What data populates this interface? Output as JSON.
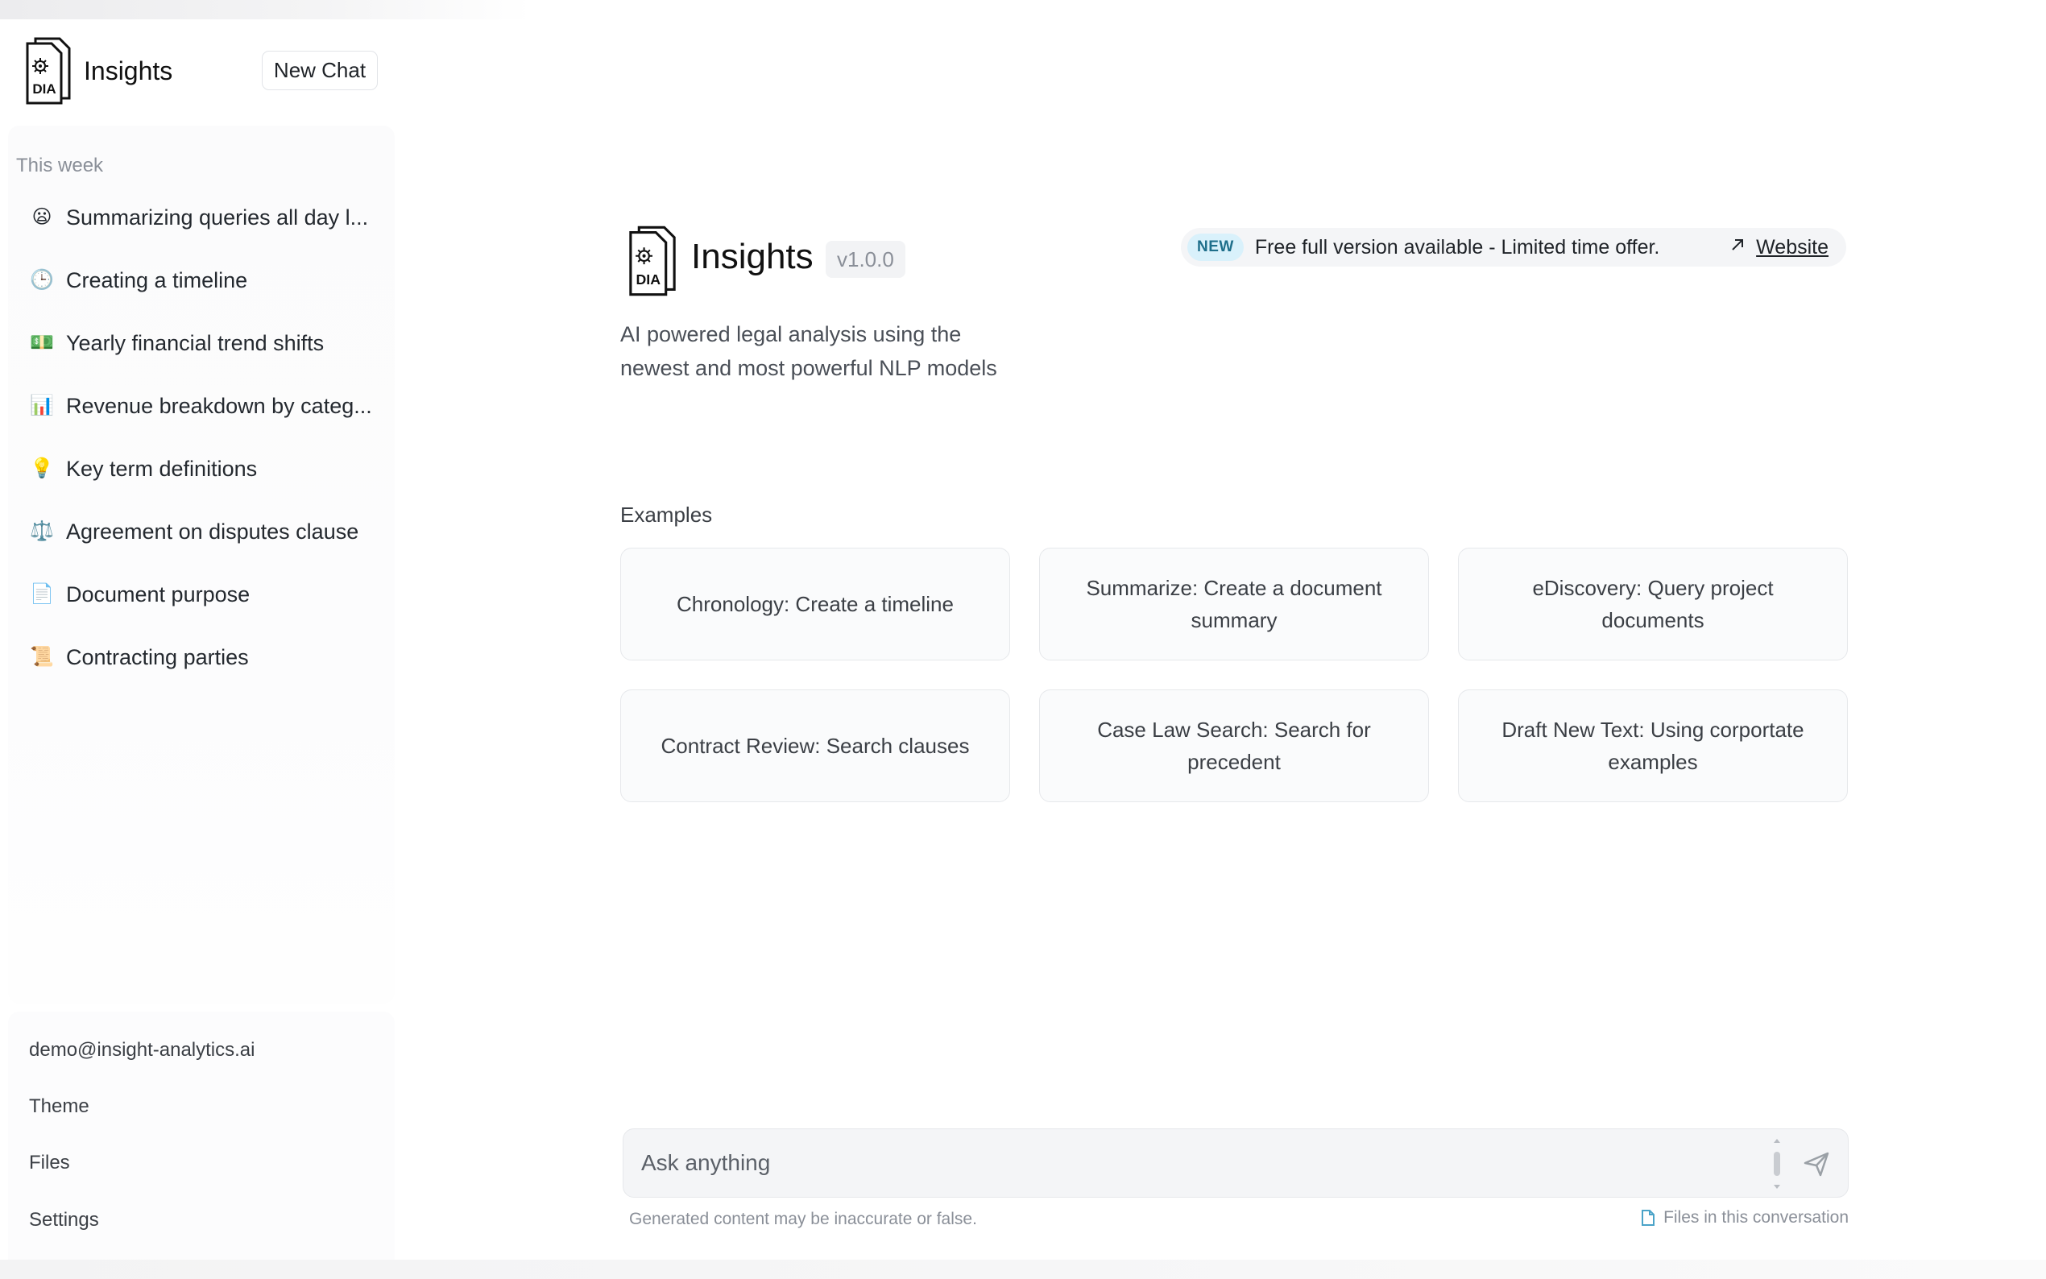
{
  "app": {
    "name": "Insights",
    "logo_text": "DIA"
  },
  "sidebar": {
    "new_chat_label": "New Chat",
    "section_label": "This week",
    "items": [
      {
        "emoji": "😦",
        "icon": "worried-face-icon",
        "label": "Summarizing queries all day l..."
      },
      {
        "emoji": "🕒",
        "icon": "clock-icon",
        "label": "Creating a timeline"
      },
      {
        "emoji": "💵",
        "icon": "money-icon",
        "label": "Yearly financial trend shifts"
      },
      {
        "emoji": "📊",
        "icon": "bar-chart-icon",
        "label": "Revenue breakdown by categ..."
      },
      {
        "emoji": "💡",
        "icon": "lightbulb-icon",
        "label": "Key term definitions"
      },
      {
        "emoji": "⚖️",
        "icon": "scales-icon",
        "label": "Agreement on disputes clause"
      },
      {
        "emoji": "📄",
        "icon": "document-icon",
        "label": "Document purpose"
      },
      {
        "emoji": "📜",
        "icon": "scroll-icon",
        "label": "Contracting parties"
      }
    ],
    "footer": {
      "email": "demo@insight-analytics.ai",
      "theme": "Theme",
      "files": "Files",
      "settings": "Settings"
    }
  },
  "main": {
    "title": "Insights",
    "version": "v1.0.0",
    "tagline": "AI powered legal analysis using the newest and most powerful NLP models",
    "promo": {
      "tag": "NEW",
      "text": "Free full version available - Limited time offer.",
      "link": "Website"
    },
    "examples_label": "Examples",
    "examples": [
      "Chronology: Create a timeline",
      "Summarize: Create a document summary",
      "eDiscovery: Query project documents",
      "Contract Review: Search clauses",
      "Case Law Search: Search for precedent",
      "Draft New Text: Using corportate examples"
    ],
    "composer": {
      "placeholder": "Ask anything",
      "disclaimer": "Generated content may be inaccurate or false.",
      "files_link": "Files in this conversation"
    }
  },
  "colors": {
    "new_tag_bg": "#d9f1fb",
    "new_tag_text": "#1f6f8b",
    "files_icon": "#4aa3c8"
  }
}
